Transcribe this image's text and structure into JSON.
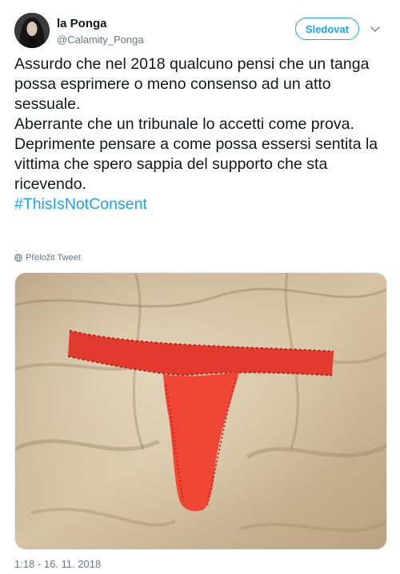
{
  "author": {
    "name": "la Ponga",
    "handle": "@Calamity_Ponga"
  },
  "follow_button": "Sledovat",
  "tweet": {
    "lines": [
      "Assurdo che nel 2018 qualcuno pensi che un tanga possa esprimere o meno consenso ad un atto sessuale.",
      "Aberrante che un tribunale lo accetti come prova.",
      "Deprimente pensare a come possa essersi sentita la vittima che spero sappia del supporto che sta ricevendo."
    ],
    "hashtag": "#ThisIsNotConsent"
  },
  "translate_label": "Přeložit Tweet",
  "timestamp": "1:18 - 16. 11. 2018",
  "icons": {
    "menu": "chevron-down-icon",
    "translate": "globe-icon"
  },
  "colors": {
    "accent": "#1da1f2",
    "secondary_text": "#657786",
    "thong": "#e8302a",
    "bedding": "#c9b392"
  }
}
